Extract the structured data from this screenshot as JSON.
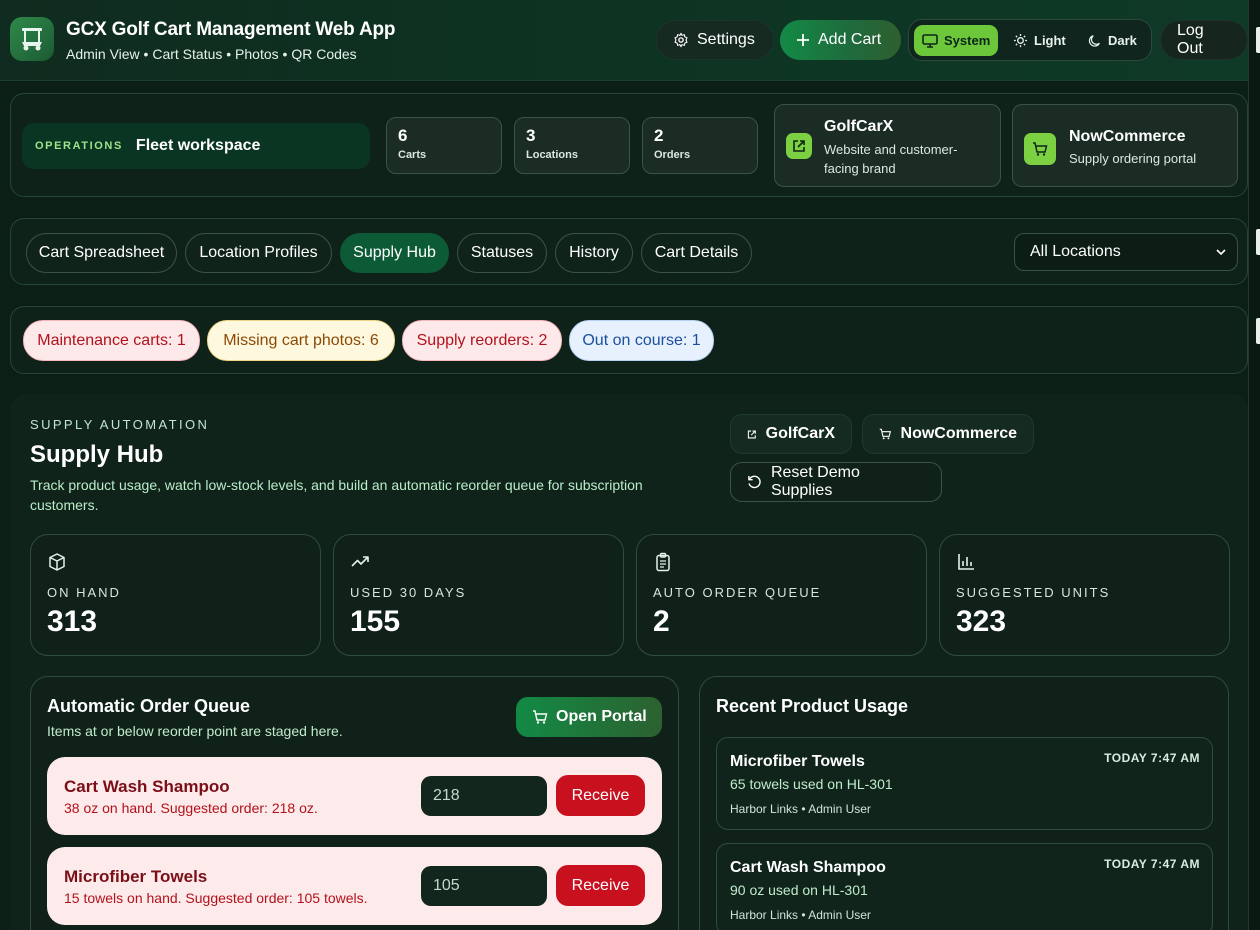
{
  "header": {
    "title": "GCX Golf Cart Management Web App",
    "subtitle": "Admin View • Cart Status • Photos • QR Codes",
    "settings_label": "Settings",
    "add_cart_label": "Add Cart",
    "theme": {
      "system": "System",
      "light": "Light",
      "dark": "Dark",
      "selected": "System"
    },
    "logout_label": "Log Out"
  },
  "workspace": {
    "ops_label": "OPERATIONS",
    "ops_title": "Fleet workspace",
    "stats": [
      {
        "value": "6",
        "label": "Carts"
      },
      {
        "value": "3",
        "label": "Locations"
      },
      {
        "value": "2",
        "label": "Orders"
      }
    ],
    "brands": [
      {
        "name": "GolfCarX",
        "desc": "Website and customer-facing brand",
        "icon": "external-link-icon"
      },
      {
        "name": "NowCommerce",
        "desc": "Supply ordering portal",
        "icon": "cart-icon"
      }
    ]
  },
  "tabs": {
    "items": [
      "Cart Spreadsheet",
      "Location Profiles",
      "Supply Hub",
      "Statuses",
      "History",
      "Cart Details"
    ],
    "active": "Supply Hub",
    "location_filter": "All Locations"
  },
  "alerts": [
    "Maintenance carts: 1",
    "Missing cart photos: 6",
    "Supply reorders: 2",
    "Out on course: 1"
  ],
  "supply_hub": {
    "kicker": "SUPPLY AUTOMATION",
    "title": "Supply Hub",
    "description": "Track product usage, watch low-stock levels, and build an automatic reorder queue for subscription customers.",
    "actions": {
      "golfcarx": "GolfCarX",
      "nowcommerce": "NowCommerce",
      "reset": "Reset Demo Supplies"
    },
    "kpis": [
      {
        "label": "ON HAND",
        "value": "313",
        "icon": "box-icon"
      },
      {
        "label": "USED 30 DAYS",
        "value": "155",
        "icon": "trending-up-icon"
      },
      {
        "label": "AUTO ORDER QUEUE",
        "value": "2",
        "icon": "clipboard-icon"
      },
      {
        "label": "SUGGESTED UNITS",
        "value": "323",
        "icon": "bar-chart-icon"
      }
    ],
    "queue": {
      "title": "Automatic Order Queue",
      "description": "Items at or below reorder point are staged here.",
      "portal_label": "Open Portal",
      "items": [
        {
          "name": "Cart Wash Shampoo",
          "note": "38 oz on hand. Suggested order: 218 oz.",
          "qty": "218",
          "action": "Receive"
        },
        {
          "name": "Microfiber Towels",
          "note": "15 towels on hand. Suggested order: 105 towels.",
          "qty": "105",
          "action": "Receive"
        }
      ]
    },
    "usage": {
      "title": "Recent Product Usage",
      "items": [
        {
          "name": "Microfiber Towels",
          "note": "65 towels used on HL-301",
          "meta": "Harbor Links • Admin User",
          "time": "TODAY 7:47 AM"
        },
        {
          "name": "Cart Wash Shampoo",
          "note": "90 oz used on HL-301",
          "meta": "Harbor Links • Admin User",
          "time": "TODAY 7:47 AM"
        }
      ]
    }
  }
}
